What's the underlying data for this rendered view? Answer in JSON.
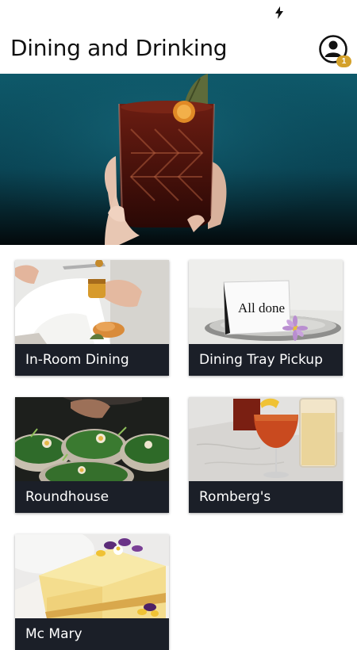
{
  "header": {
    "title": "Dining and Drinking",
    "notification_count": "1"
  },
  "icons": {
    "status": "lightning-bolt-icon",
    "profile": "user-profile-icon"
  },
  "colors": {
    "card_label_bg": "#1b1f28",
    "badge": "#d4a12a",
    "hero_bg": "#0d5363"
  },
  "cards": [
    {
      "label": "In-Room Dining"
    },
    {
      "label": "Dining Tray Pickup",
      "image_text": "All done"
    },
    {
      "label": "Roundhouse"
    },
    {
      "label": "Romberg's"
    },
    {
      "label": "Mc Mary"
    }
  ]
}
